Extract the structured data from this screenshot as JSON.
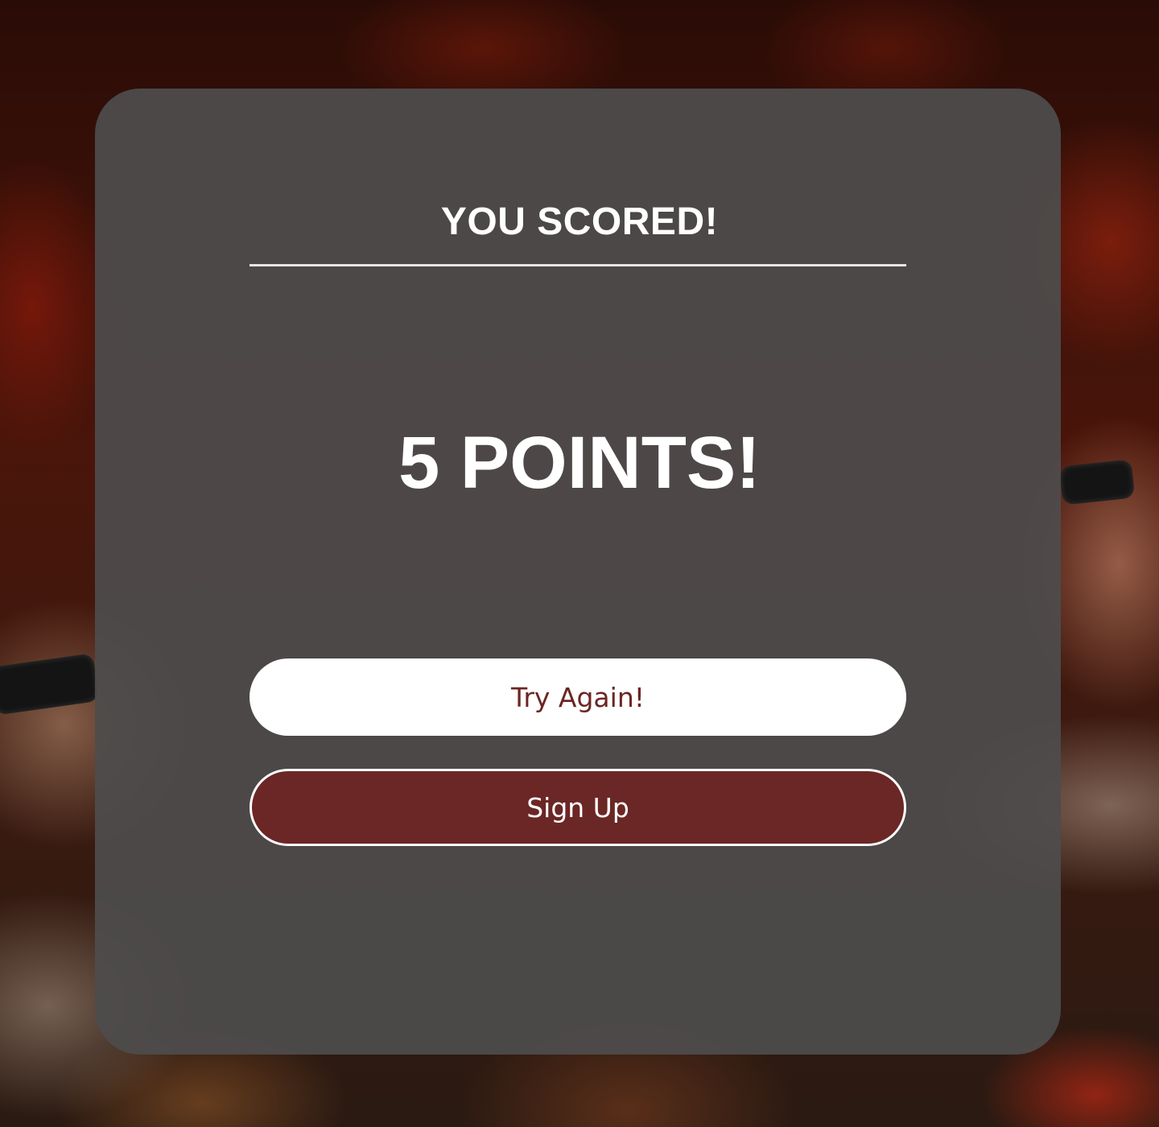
{
  "result": {
    "heading": "YOU SCORED!",
    "score_text": "5 POINTS!"
  },
  "actions": {
    "try_again_label": "Try Again!",
    "sign_up_label": "Sign Up"
  },
  "colors": {
    "brand_maroon": "#6b2725",
    "card_overlay": "#4e4c4c",
    "text_light": "#ffffff"
  }
}
